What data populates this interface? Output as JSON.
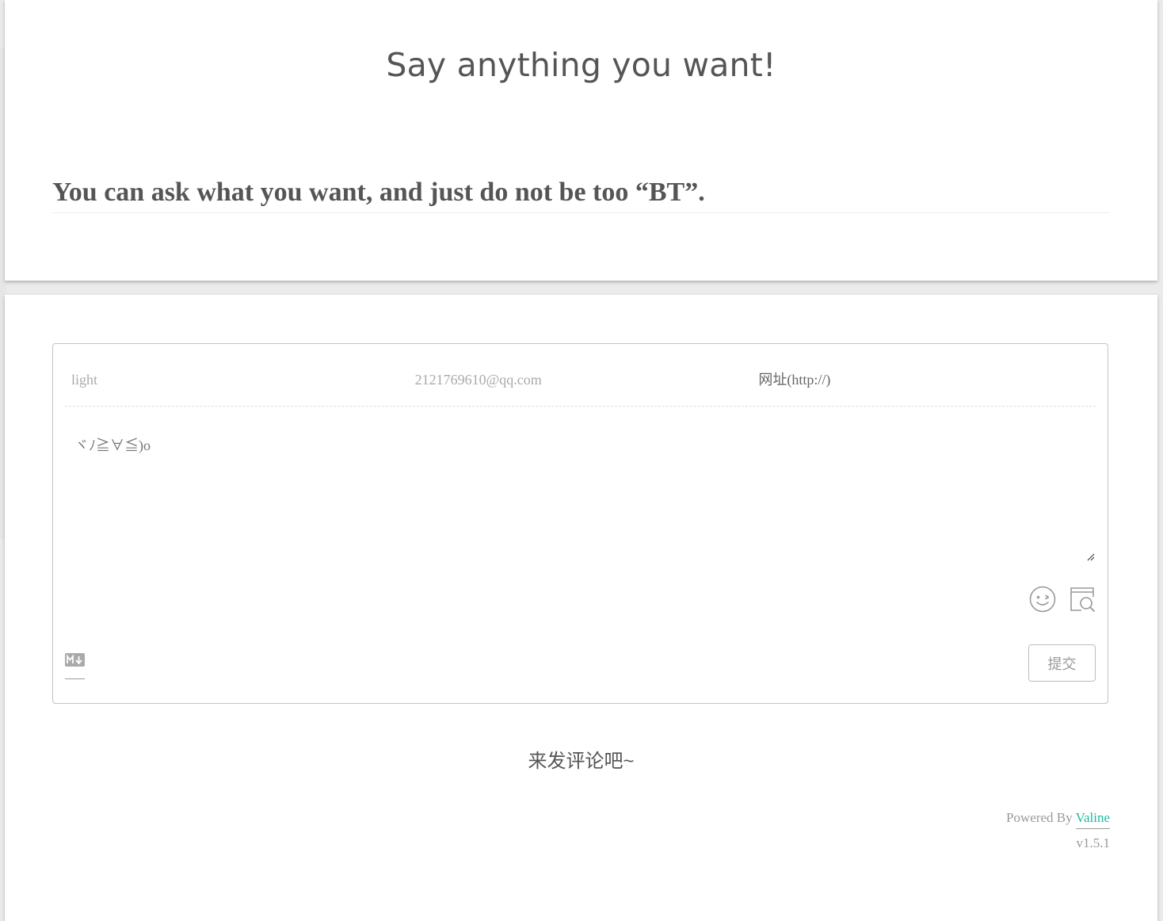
{
  "page": {
    "title": "Say anything you want!",
    "intro_heading": "You can ask what you want, and just do not be too “BT”."
  },
  "comment_form": {
    "nickname_placeholder": "light",
    "email_placeholder": "2121769610@qq.com",
    "url_placeholder": "网址(http://)",
    "content_placeholder": "ヾﾉ≧∀≦)o",
    "submit_label": "提交",
    "emoji_icon": "smile-wink-icon",
    "preview_icon": "preview-icon",
    "markdown_icon": "markdown-icon"
  },
  "comments": {
    "empty_text": "来发评论吧~"
  },
  "footer": {
    "powered_prefix": "Powered By ",
    "powered_link": "Valine",
    "version": "v1.5.1"
  },
  "colors": {
    "accent": "#1abc9c",
    "text": "#555555",
    "muted": "#999999"
  }
}
